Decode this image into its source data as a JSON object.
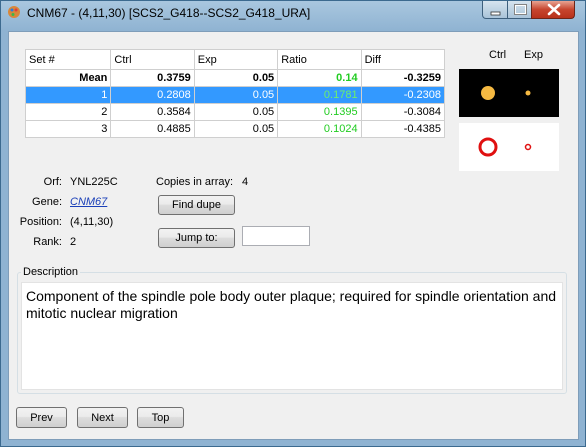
{
  "window": {
    "title": "CNM67 - (4,11,30) [SCS2_G418--SCS2_G418_URA]"
  },
  "table": {
    "headers": [
      "Set #",
      "Ctrl",
      "Exp",
      "Ratio",
      "Diff"
    ],
    "mean": {
      "label": "Mean",
      "ctrl": "0.3759",
      "exp": "0.05",
      "ratio": "0.14",
      "diff": "-0.3259"
    },
    "rows": [
      {
        "set": "1",
        "ctrl": "0.2808",
        "exp": "0.05",
        "ratio": "0.1781",
        "diff": "-0.2308"
      },
      {
        "set": "2",
        "ctrl": "0.3584",
        "exp": "0.05",
        "ratio": "0.1395",
        "diff": "-0.3084"
      },
      {
        "set": "3",
        "ctrl": "0.4885",
        "exp": "0.05",
        "ratio": "0.1024",
        "diff": "-0.4385"
      }
    ]
  },
  "thumbnails": {
    "ctrl_label": "Ctrl",
    "exp_label": "Exp"
  },
  "info": {
    "orf_label": "Orf:",
    "orf_value": "YNL225C",
    "gene_label": "Gene:",
    "gene_value": "CNM67",
    "position_label": "Position:",
    "position_value": "(4,11,30)",
    "rank_label": "Rank:",
    "rank_value": "2",
    "copies_label": "Copies in array:",
    "copies_value": "4"
  },
  "buttons": {
    "find_dupe": "Find dupe",
    "jump_to": "Jump to:",
    "prev": "Prev",
    "next": "Next",
    "top": "Top"
  },
  "jump_input": {
    "value": ""
  },
  "description": {
    "title": "Description",
    "text": "Component of the spindle pole body outer plaque; required for spindle orientation and mitotic nuclear migration"
  },
  "colors": {
    "selection": "#3399ff",
    "ratio_green": "#22cc22",
    "spot_fill": "#f5b942",
    "spot_ring": "#e01010"
  }
}
